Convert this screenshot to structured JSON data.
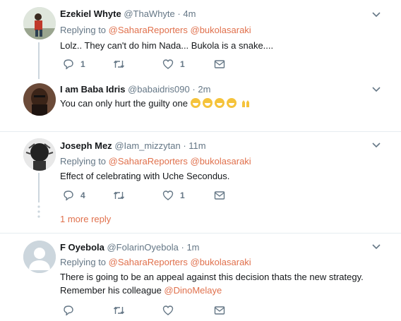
{
  "tweets": [
    {
      "name": "Ezekiel Whyte",
      "handle": "@ThaWhyte",
      "time": "4m",
      "replying_label": "Replying to",
      "mention1": "@SaharaReporters",
      "mention2": "@bukolasaraki",
      "text": "Lolz..  They can't do him Nada...  Bukola is a snake....",
      "reply_count": "1",
      "like_count": "1"
    },
    {
      "name": "I am Baba Idris",
      "handle": "@babaidris090",
      "time": "2m",
      "text": "You can only hurt the guilty one"
    },
    {
      "name": "Joseph Mez",
      "handle": "@Iam_mizzytan",
      "time": "11m",
      "replying_label": "Replying to",
      "mention1": "@SaharaReporters",
      "mention2": "@bukolasaraki",
      "text": "Effect of celebrating with Uche Secondus.",
      "reply_count": "4",
      "like_count": "1"
    },
    {
      "name": "F Oyebola",
      "handle": "@FolarinOyebola",
      "time": "1m",
      "replying_label": "Replying to",
      "mention1": "@SaharaReporters",
      "mention2": "@bukolasaraki",
      "text_line1": "There is going to be an appeal against this decision thats the new strategy.",
      "text_line2_prefix": "Remember his colleague",
      "text_line2_mention": "@DinoMelaye"
    }
  ],
  "more_replies": "1 more reply",
  "separator": "·",
  "icons": [
    "reply-icon",
    "retweet-icon",
    "like-icon",
    "dm-icon",
    "chevron-down-icon",
    "grinning-emoji-icon",
    "raised-hands-emoji-icon"
  ],
  "colors": {
    "link": "#e0704c",
    "muted": "#657786",
    "divider": "#e6ecf0"
  }
}
